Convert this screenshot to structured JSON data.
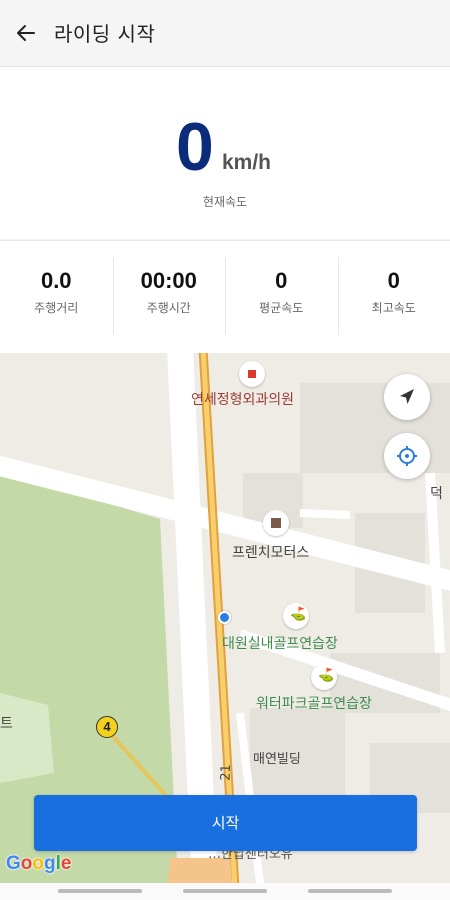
{
  "header": {
    "title": "라이딩 시작",
    "back_icon": "arrow-left-icon"
  },
  "speed": {
    "value": "0",
    "unit": "km/h",
    "label": "현재속도"
  },
  "stats": [
    {
      "value": "0.0",
      "label": "주행거리"
    },
    {
      "value": "00:00",
      "label": "주행시간"
    },
    {
      "value": "0",
      "label": "평균속도"
    },
    {
      "value": "0",
      "label": "최고속도"
    }
  ],
  "map": {
    "pois": [
      {
        "name": "연세정형외과의원",
        "type": "hospital"
      },
      {
        "name": "프렌치모터스",
        "type": "store"
      },
      {
        "name": "대원실내골프연습장",
        "type": "golf"
      },
      {
        "name": "워터파크골프연습장",
        "type": "golf"
      }
    ],
    "buildings": {
      "maeyeon": "매연빌딩",
      "right_edge": "덕",
      "left_edge": "트",
      "partial_street": "21",
      "bottom_partial": "…한납센터오유"
    },
    "route_number": "4",
    "attribution": "Google",
    "controls": {
      "navigate_icon": "navigation-arrow-icon",
      "locate_icon": "crosshair-target-icon"
    }
  },
  "actions": {
    "start_label": "시작"
  },
  "colors": {
    "speed": "#0b2c7a",
    "primary_button": "#1a6fe0",
    "road_orange": "#f2a533",
    "park_green": "#c3d9a7"
  }
}
